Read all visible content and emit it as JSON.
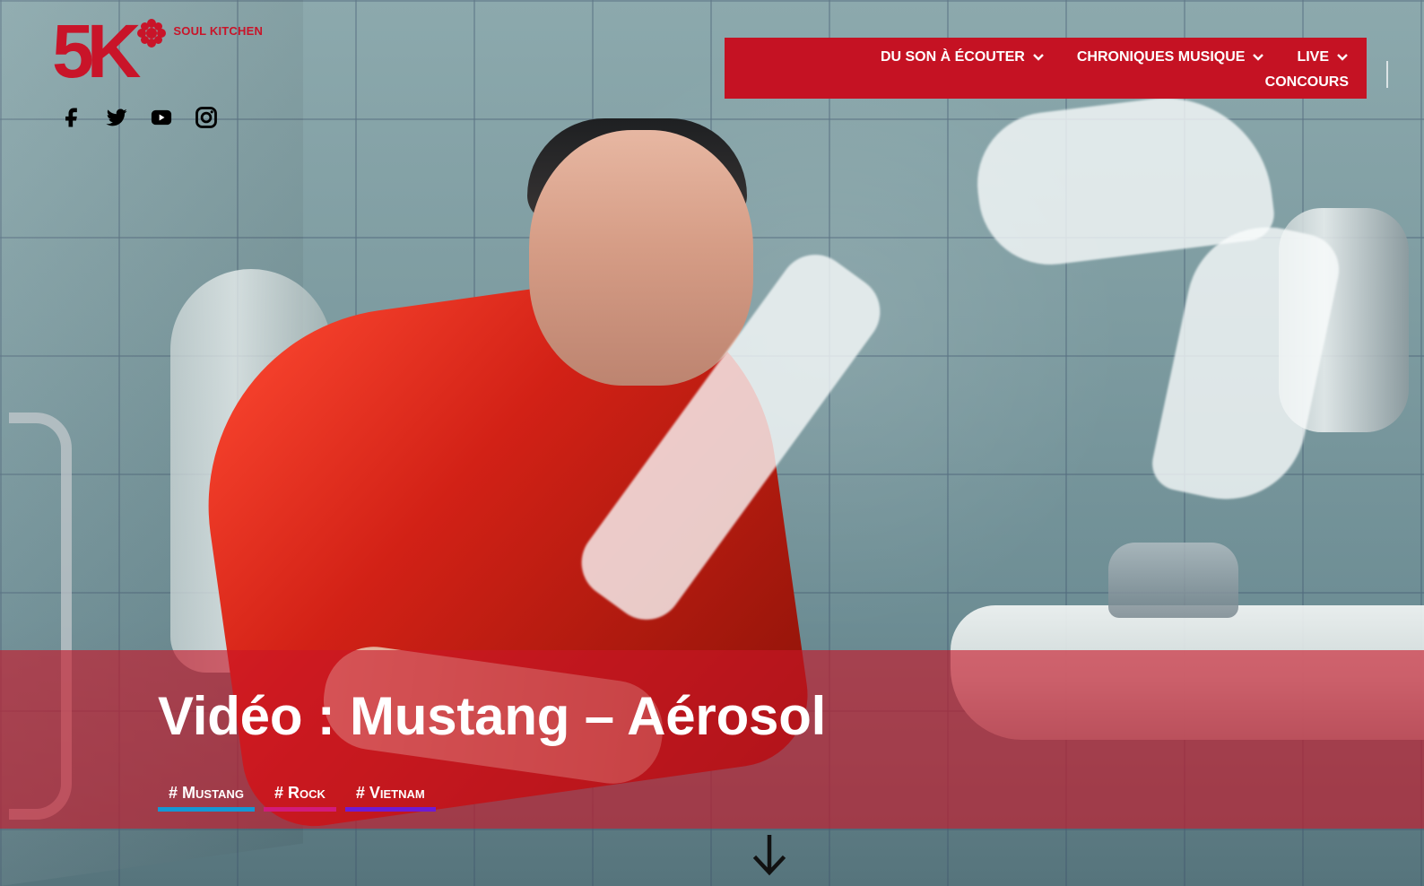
{
  "site": {
    "logo_mark": "5K",
    "logo_text": "SOUL KITCHEN",
    "brand_color": "#c51223",
    "social_icons": [
      {
        "name": "facebook-icon"
      },
      {
        "name": "twitter-icon"
      },
      {
        "name": "youtube-icon"
      },
      {
        "name": "instagram-icon"
      }
    ]
  },
  "nav": {
    "items": [
      {
        "label": "DU SON À ÉCOUTER"
      },
      {
        "label": "CHRONIQUES MUSIQUE"
      },
      {
        "label": "LIVE"
      }
    ],
    "secondary": {
      "label": "CONCOURS"
    }
  },
  "hero": {
    "title": "Vidéo : Mustang – Aérosol",
    "tags": [
      {
        "prefix": "# ",
        "label": "Mustang",
        "color": "#1597d4"
      },
      {
        "prefix": "# ",
        "label": "Rock",
        "color": "#d21b7b"
      },
      {
        "prefix": "# ",
        "label": "Vietnam",
        "color": "#6f1bd4"
      }
    ]
  }
}
